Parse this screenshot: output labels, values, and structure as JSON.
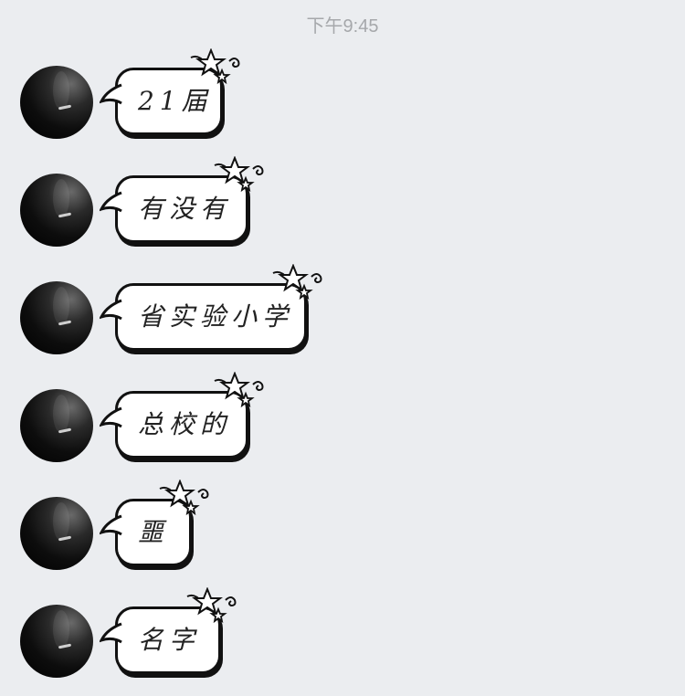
{
  "chat": {
    "timestamp": "下午9:45",
    "messages": [
      {
        "text": "21届"
      },
      {
        "text": "有没有"
      },
      {
        "text": "省实验小学"
      },
      {
        "text": "总校的"
      },
      {
        "text": "噩"
      },
      {
        "text": "名字"
      }
    ]
  },
  "icons": {
    "avatar": "profile-avatar",
    "bubble_decoration": "stars-decoration-icon"
  },
  "colors": {
    "background": "#ebedf0",
    "bubble_fill": "#ffffff",
    "bubble_outline": "#111111",
    "timestamp": "#a6a8ab"
  }
}
